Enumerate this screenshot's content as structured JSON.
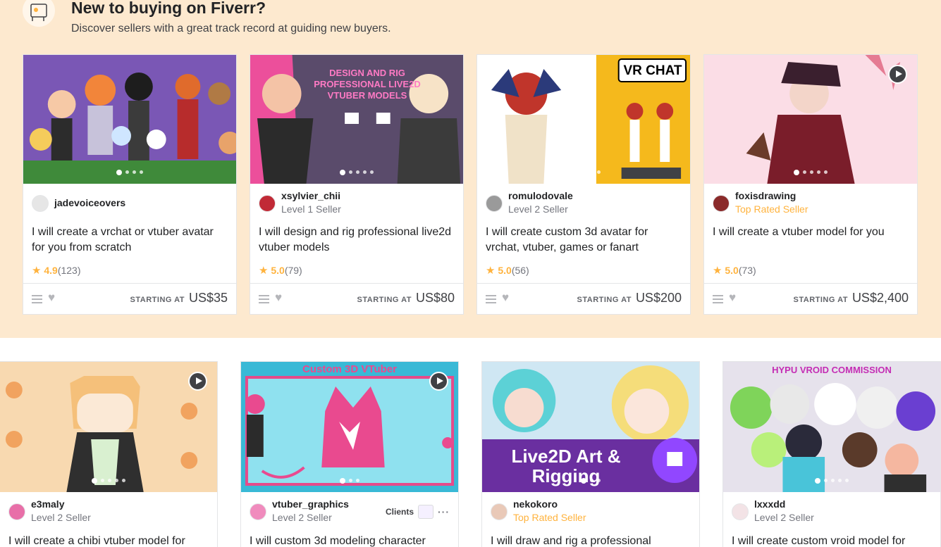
{
  "promo": {
    "title": "New to buying on Fiverr?",
    "subtitle": "Discover sellers with a great track record at guiding new buyers."
  },
  "price_label": "STARTING AT",
  "row1": [
    {
      "seller_name": "jadevoiceovers",
      "seller_level": "",
      "title": "I will create a vrchat or vtuber avatar for you from scratch",
      "rating": "4.9",
      "reviews": "(123)",
      "price": "US$35",
      "thumb_bg": "#7a57b5",
      "thumb_text": ""
    },
    {
      "seller_name": "xsylvier_chii",
      "seller_level": "Level 1 Seller",
      "title": "I will design and rig professional live2d vtuber models",
      "rating": "5.0",
      "reviews": "(79)",
      "price": "US$80",
      "thumb_bg": "#5a4b6b",
      "thumb_text": "DESIGN AND RIG PROFESSIONAL LIVE2D VTUBER MODELS"
    },
    {
      "seller_name": "romulodovale",
      "seller_level": "Level 2 Seller",
      "title": "I will create custom 3d avatar for vrchat, vtuber, games or fanart",
      "rating": "5.0",
      "reviews": "(56)",
      "price": "US$200",
      "thumb_bg": "#f5b91c",
      "thumb_text": "VR CHAT"
    },
    {
      "seller_name": "foxisdrawing",
      "seller_level": "Top Rated Seller",
      "title": "I will create a vtuber model for you",
      "rating": "5.0",
      "reviews": "(73)",
      "price": "US$2,400",
      "thumb_bg": "#fbdde6",
      "thumb_text": ""
    }
  ],
  "row2": [
    {
      "seller_name": "e3maly",
      "seller_level": "Level 2 Seller",
      "title": "I will create a chibi vtuber model for",
      "thumb_bg": "#f8d9b0",
      "thumb_text": ""
    },
    {
      "seller_name": "vtuber_graphics",
      "seller_level": "Level 2 Seller",
      "clients_label": "Clients",
      "title": "I will custom 3d modeling character",
      "thumb_bg": "#39b9d6",
      "thumb_text": "Custom 3D VTuber"
    },
    {
      "seller_name": "nekokoro",
      "seller_level": "Top Rated Seller",
      "title": "I will draw and rig a professional",
      "thumb_bg": "#6a2fa0",
      "thumb_text": "Live2D Art & Rigging"
    },
    {
      "seller_name": "lxxxdd",
      "seller_level": "Level 2 Seller",
      "title": "I will create custom vroid model for",
      "thumb_bg": "#e6e2ec",
      "thumb_text": "HYPU VROID COMMISSION"
    }
  ]
}
